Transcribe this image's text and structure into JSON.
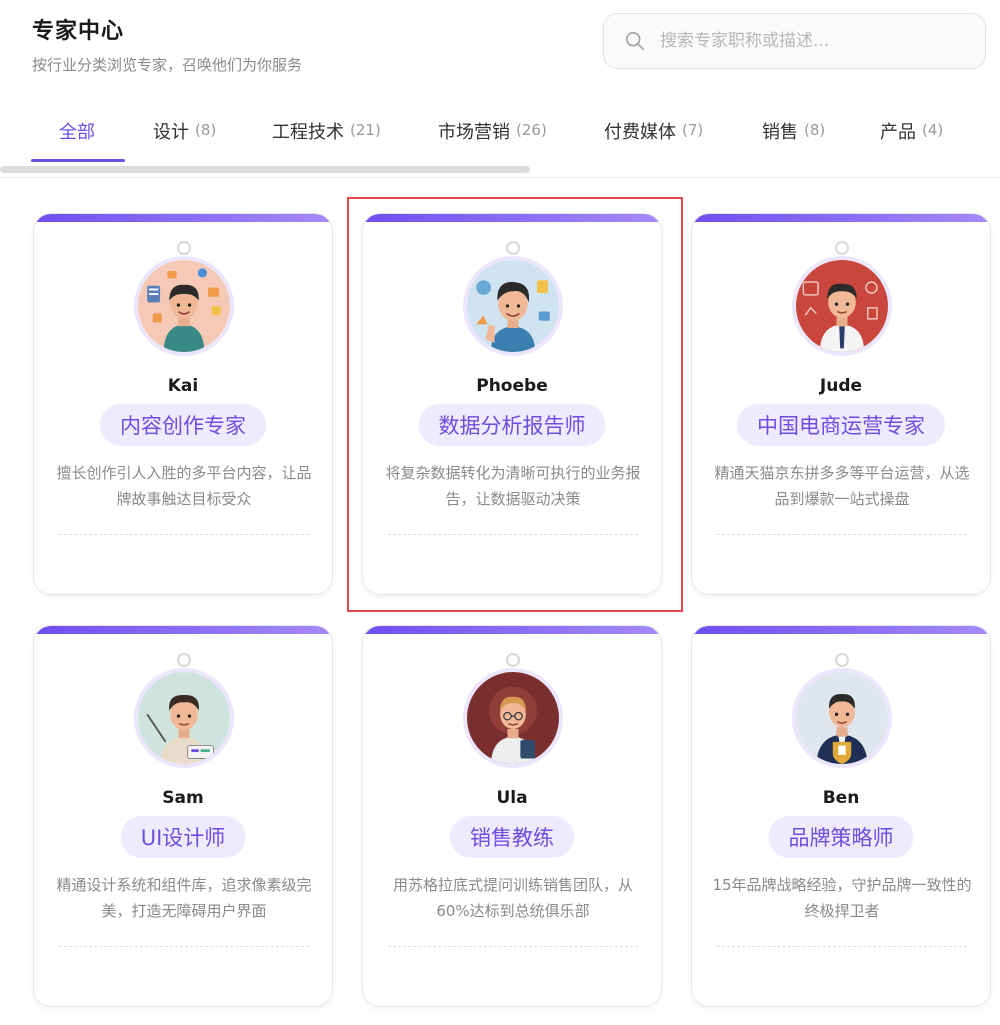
{
  "header": {
    "title": "专家中心",
    "subtitle": "按行业分类浏览专家，召唤他们为你服务"
  },
  "search": {
    "placeholder": "搜索专家职称或描述...",
    "value": ""
  },
  "tabs": [
    {
      "label": "全部",
      "count": ""
    },
    {
      "label": "设计",
      "count": "(8)"
    },
    {
      "label": "工程技术",
      "count": "(21)"
    },
    {
      "label": "市场营销",
      "count": "(26)"
    },
    {
      "label": "付费媒体",
      "count": "(7)"
    },
    {
      "label": "销售",
      "count": "(8)"
    },
    {
      "label": "产品",
      "count": "(4)"
    }
  ],
  "active_tab": "全部",
  "experts": [
    {
      "name": "Kai",
      "role": "内容创作专家",
      "desc": "擅长创作引人入胜的多平台内容，让品牌故事触达目标受众",
      "avatar": "kai-avatar"
    },
    {
      "name": "Phoebe",
      "role": "数据分析报告师",
      "desc": "将复杂数据转化为清晰可执行的业务报告，让数据驱动决策",
      "avatar": "phoebe-avatar"
    },
    {
      "name": "Jude",
      "role": "中国电商运营专家",
      "desc": "精通天猫京东拼多多等平台运营，从选品到爆款一站式操盘",
      "avatar": "jude-avatar"
    },
    {
      "name": "Sam",
      "role": "UI设计师",
      "desc": "精通设计系统和组件库，追求像素级完美，打造无障碍用户界面",
      "avatar": "sam-avatar"
    },
    {
      "name": "Ula",
      "role": "销售教练",
      "desc": "用苏格拉底式提问训练销售团队，从60%达标到总统俱乐部",
      "avatar": "ula-avatar"
    },
    {
      "name": "Ben",
      "role": "品牌策略师",
      "desc": "15年品牌战略经验，守护品牌一致性的终极捍卫者",
      "avatar": "ben-avatar"
    }
  ],
  "colors": {
    "accent": "#6b4fe0",
    "badge_bg": "#efeafd",
    "highlight": "#e5484d"
  }
}
